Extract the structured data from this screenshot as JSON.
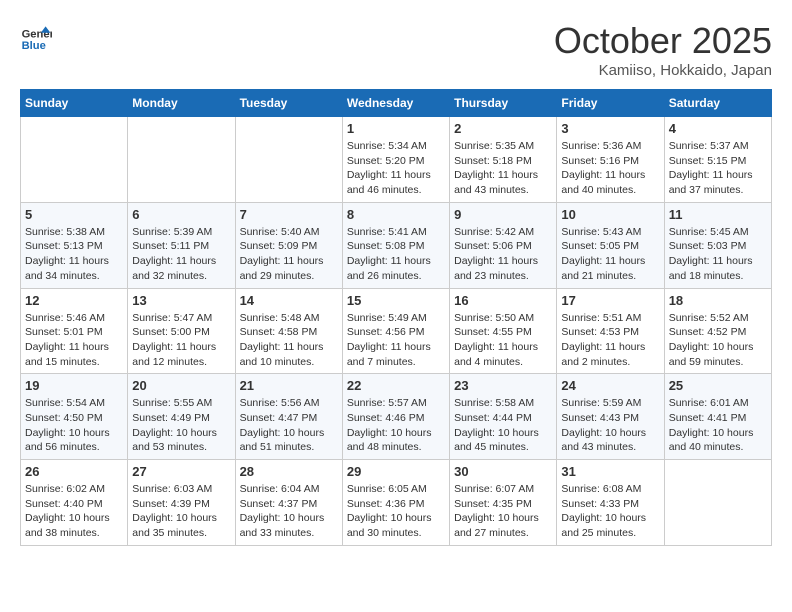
{
  "header": {
    "logo_line1": "General",
    "logo_line2": "Blue",
    "month": "October 2025",
    "location": "Kamiiso, Hokkaido, Japan"
  },
  "weekdays": [
    "Sunday",
    "Monday",
    "Tuesday",
    "Wednesday",
    "Thursday",
    "Friday",
    "Saturday"
  ],
  "weeks": [
    [
      {
        "day": "",
        "info": ""
      },
      {
        "day": "",
        "info": ""
      },
      {
        "day": "",
        "info": ""
      },
      {
        "day": "1",
        "info": "Sunrise: 5:34 AM\nSunset: 5:20 PM\nDaylight: 11 hours\nand 46 minutes."
      },
      {
        "day": "2",
        "info": "Sunrise: 5:35 AM\nSunset: 5:18 PM\nDaylight: 11 hours\nand 43 minutes."
      },
      {
        "day": "3",
        "info": "Sunrise: 5:36 AM\nSunset: 5:16 PM\nDaylight: 11 hours\nand 40 minutes."
      },
      {
        "day": "4",
        "info": "Sunrise: 5:37 AM\nSunset: 5:15 PM\nDaylight: 11 hours\nand 37 minutes."
      }
    ],
    [
      {
        "day": "5",
        "info": "Sunrise: 5:38 AM\nSunset: 5:13 PM\nDaylight: 11 hours\nand 34 minutes."
      },
      {
        "day": "6",
        "info": "Sunrise: 5:39 AM\nSunset: 5:11 PM\nDaylight: 11 hours\nand 32 minutes."
      },
      {
        "day": "7",
        "info": "Sunrise: 5:40 AM\nSunset: 5:09 PM\nDaylight: 11 hours\nand 29 minutes."
      },
      {
        "day": "8",
        "info": "Sunrise: 5:41 AM\nSunset: 5:08 PM\nDaylight: 11 hours\nand 26 minutes."
      },
      {
        "day": "9",
        "info": "Sunrise: 5:42 AM\nSunset: 5:06 PM\nDaylight: 11 hours\nand 23 minutes."
      },
      {
        "day": "10",
        "info": "Sunrise: 5:43 AM\nSunset: 5:05 PM\nDaylight: 11 hours\nand 21 minutes."
      },
      {
        "day": "11",
        "info": "Sunrise: 5:45 AM\nSunset: 5:03 PM\nDaylight: 11 hours\nand 18 minutes."
      }
    ],
    [
      {
        "day": "12",
        "info": "Sunrise: 5:46 AM\nSunset: 5:01 PM\nDaylight: 11 hours\nand 15 minutes."
      },
      {
        "day": "13",
        "info": "Sunrise: 5:47 AM\nSunset: 5:00 PM\nDaylight: 11 hours\nand 12 minutes."
      },
      {
        "day": "14",
        "info": "Sunrise: 5:48 AM\nSunset: 4:58 PM\nDaylight: 11 hours\nand 10 minutes."
      },
      {
        "day": "15",
        "info": "Sunrise: 5:49 AM\nSunset: 4:56 PM\nDaylight: 11 hours\nand 7 minutes."
      },
      {
        "day": "16",
        "info": "Sunrise: 5:50 AM\nSunset: 4:55 PM\nDaylight: 11 hours\nand 4 minutes."
      },
      {
        "day": "17",
        "info": "Sunrise: 5:51 AM\nSunset: 4:53 PM\nDaylight: 11 hours\nand 2 minutes."
      },
      {
        "day": "18",
        "info": "Sunrise: 5:52 AM\nSunset: 4:52 PM\nDaylight: 10 hours\nand 59 minutes."
      }
    ],
    [
      {
        "day": "19",
        "info": "Sunrise: 5:54 AM\nSunset: 4:50 PM\nDaylight: 10 hours\nand 56 minutes."
      },
      {
        "day": "20",
        "info": "Sunrise: 5:55 AM\nSunset: 4:49 PM\nDaylight: 10 hours\nand 53 minutes."
      },
      {
        "day": "21",
        "info": "Sunrise: 5:56 AM\nSunset: 4:47 PM\nDaylight: 10 hours\nand 51 minutes."
      },
      {
        "day": "22",
        "info": "Sunrise: 5:57 AM\nSunset: 4:46 PM\nDaylight: 10 hours\nand 48 minutes."
      },
      {
        "day": "23",
        "info": "Sunrise: 5:58 AM\nSunset: 4:44 PM\nDaylight: 10 hours\nand 45 minutes."
      },
      {
        "day": "24",
        "info": "Sunrise: 5:59 AM\nSunset: 4:43 PM\nDaylight: 10 hours\nand 43 minutes."
      },
      {
        "day": "25",
        "info": "Sunrise: 6:01 AM\nSunset: 4:41 PM\nDaylight: 10 hours\nand 40 minutes."
      }
    ],
    [
      {
        "day": "26",
        "info": "Sunrise: 6:02 AM\nSunset: 4:40 PM\nDaylight: 10 hours\nand 38 minutes."
      },
      {
        "day": "27",
        "info": "Sunrise: 6:03 AM\nSunset: 4:39 PM\nDaylight: 10 hours\nand 35 minutes."
      },
      {
        "day": "28",
        "info": "Sunrise: 6:04 AM\nSunset: 4:37 PM\nDaylight: 10 hours\nand 33 minutes."
      },
      {
        "day": "29",
        "info": "Sunrise: 6:05 AM\nSunset: 4:36 PM\nDaylight: 10 hours\nand 30 minutes."
      },
      {
        "day": "30",
        "info": "Sunrise: 6:07 AM\nSunset: 4:35 PM\nDaylight: 10 hours\nand 27 minutes."
      },
      {
        "day": "31",
        "info": "Sunrise: 6:08 AM\nSunset: 4:33 PM\nDaylight: 10 hours\nand 25 minutes."
      },
      {
        "day": "",
        "info": ""
      }
    ]
  ]
}
